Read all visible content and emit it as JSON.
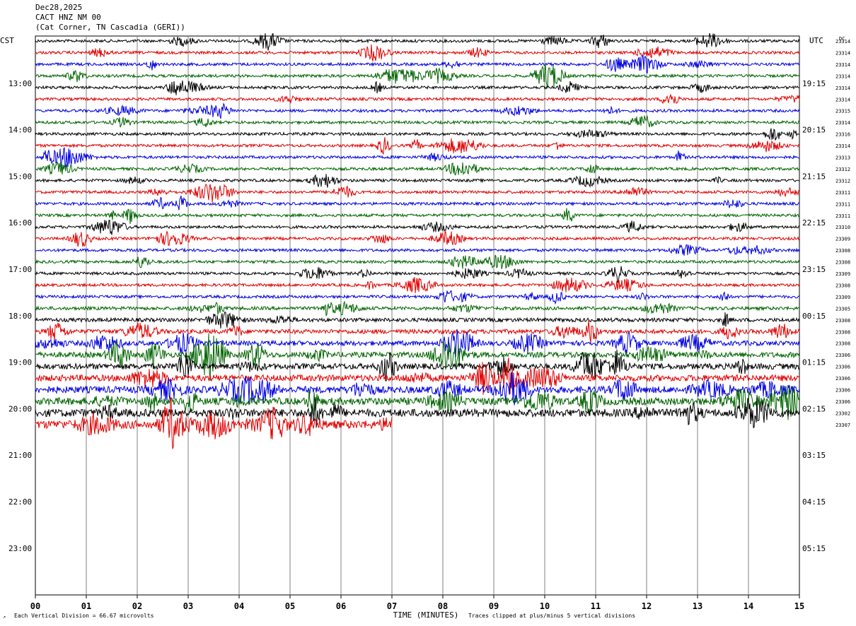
{
  "header": {
    "date": "Dec28,2025",
    "station": "CACT HNZ NM 00",
    "location": "(Cat Corner, TN Cascadia (GERI))"
  },
  "chart_data": {
    "type": "line",
    "title": "",
    "left_timezone": "CST",
    "right_timezone": "UTC",
    "dc_label": "DC",
    "xlabel": "TIME (MINUTES)",
    "xlim": [
      0,
      15
    ],
    "x_ticks": [
      "00",
      "01",
      "02",
      "03",
      "04",
      "05",
      "06",
      "07",
      "08",
      "09",
      "10",
      "11",
      "12",
      "13",
      "14",
      "15"
    ],
    "left_hour_labels": [
      "13:00",
      "14:00",
      "15:00",
      "16:00",
      "17:00",
      "18:00",
      "19:00",
      "20:00",
      "21:00",
      "22:00",
      "23:00"
    ],
    "right_hour_labels": [
      "19:15",
      "20:15",
      "21:15",
      "22:15",
      "23:15",
      "00:15",
      "01:15",
      "02:15",
      "03:15",
      "04:15",
      "05:15"
    ],
    "trace_colors": [
      "#000000",
      "#e00000",
      "#0000e0",
      "#006400"
    ],
    "traces_per_hour": 4,
    "minutes_per_trace": 15,
    "first_row_time": "12:00",
    "dc_values": [
      23314,
      23314,
      23314,
      23314,
      23314,
      23314,
      23315,
      23314,
      23316,
      23314,
      23313,
      23312,
      23312,
      23311,
      23311,
      23311,
      23310,
      23309,
      23308,
      23308,
      23309,
      23308,
      23309,
      23305,
      23308,
      23308,
      23308,
      23306,
      23306,
      23306,
      23306,
      23306,
      23302,
      23307
    ],
    "last_trace_end_minute": 7,
    "footer_left": "Each Vertical Division =    66.67 microvolts",
    "footer_right": "Traces clipped at plus/minus 5 vertical divisions"
  }
}
